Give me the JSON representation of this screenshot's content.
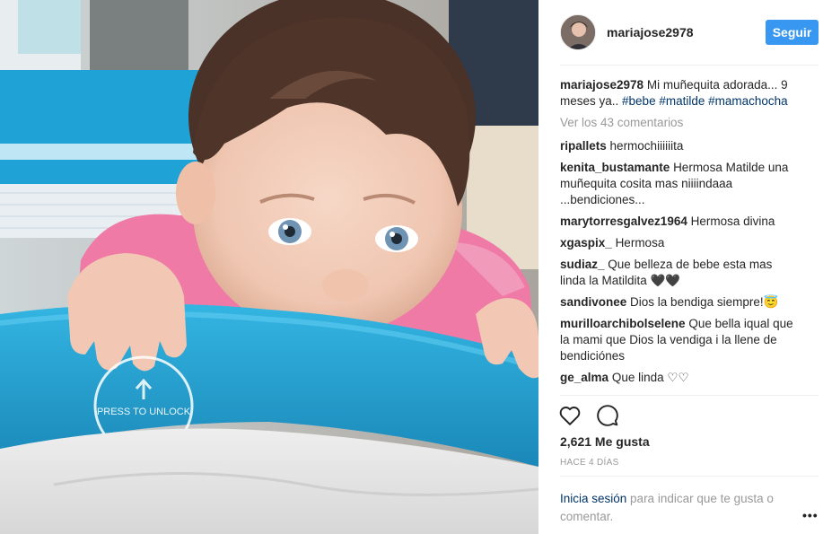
{
  "post": {
    "image_alt": "baby girl biting the blue rail of a playpen",
    "crib_label": "PRESS TO UNLOCK"
  },
  "header": {
    "username": "mariajose2978",
    "follow_label": "Seguir"
  },
  "caption": {
    "username": "mariajose2978",
    "text": "Mi muñequita adorada... 9 meses ya.. ",
    "hashtags": [
      "#bebe",
      "#matilde",
      "#mamachocha"
    ]
  },
  "view_all_comments": "Ver los 43 comentarios",
  "comments": [
    {
      "user": "ripallets",
      "text": "hermochiiiiiita"
    },
    {
      "user": "kenita_bustamante",
      "text": "Hermosa Matilde una muñequita cosita mas niiiindaaa ...bendiciones..."
    },
    {
      "user": "marytorresgalvez1964",
      "text": "Hermosa divina"
    },
    {
      "user": "xgaspix_",
      "text": "Hermosa"
    },
    {
      "user": "sudiaz_",
      "text": "Que belleza de bebe esta mas linda la Matildita 🖤🖤"
    },
    {
      "user": "sandivonee",
      "text": "Dios la bendiga siempre!😇"
    },
    {
      "user": "murilloarchibolselene",
      "text": "Que bella iqual que la mami que Dios la vendiga i la llene de bendiciónes"
    },
    {
      "user": "ge_alma",
      "text": "Que linda ♡♡"
    }
  ],
  "actions": {
    "like_icon": "heart-icon",
    "comment_icon": "comment-bubble-icon"
  },
  "likes": "2,621 Me gusta",
  "time_ago": "HACE 4 DÍAS",
  "login_prompt": {
    "link": "Inicia sesión",
    "text": " para indicar que te gusta o comentar."
  },
  "more_options": "•••"
}
